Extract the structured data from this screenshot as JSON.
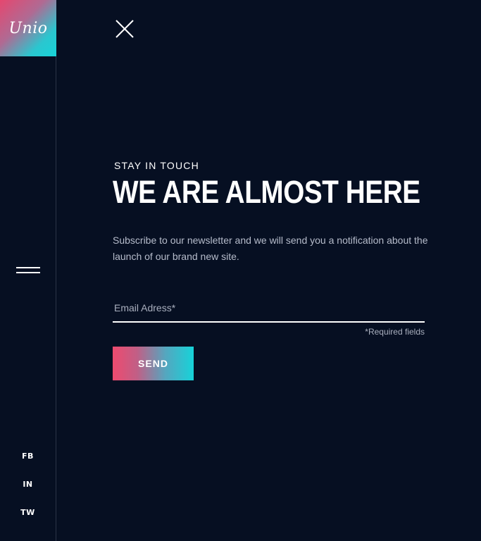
{
  "brand": {
    "logo_text": "Unio"
  },
  "sidebar": {
    "social": [
      "FB",
      "IN",
      "TW"
    ]
  },
  "main": {
    "eyebrow": "STAY IN TOUCH",
    "headline": "WE ARE ALMOST HERE",
    "description": "Subscribe to our newsletter and we will send you a notification about the launch of our brand new site.",
    "email_placeholder": "Email Adress*",
    "email_value": "",
    "required_note": "*Required fields",
    "send_label": "SEND"
  },
  "icons": {
    "close": "close-icon",
    "menu": "hamburger-menu-icon"
  },
  "colors": {
    "background": "#060f22",
    "gradient_start": "#ee4a6f",
    "gradient_end": "#16d3d9",
    "text": "#ffffff",
    "muted_text": "#b6bccb"
  }
}
